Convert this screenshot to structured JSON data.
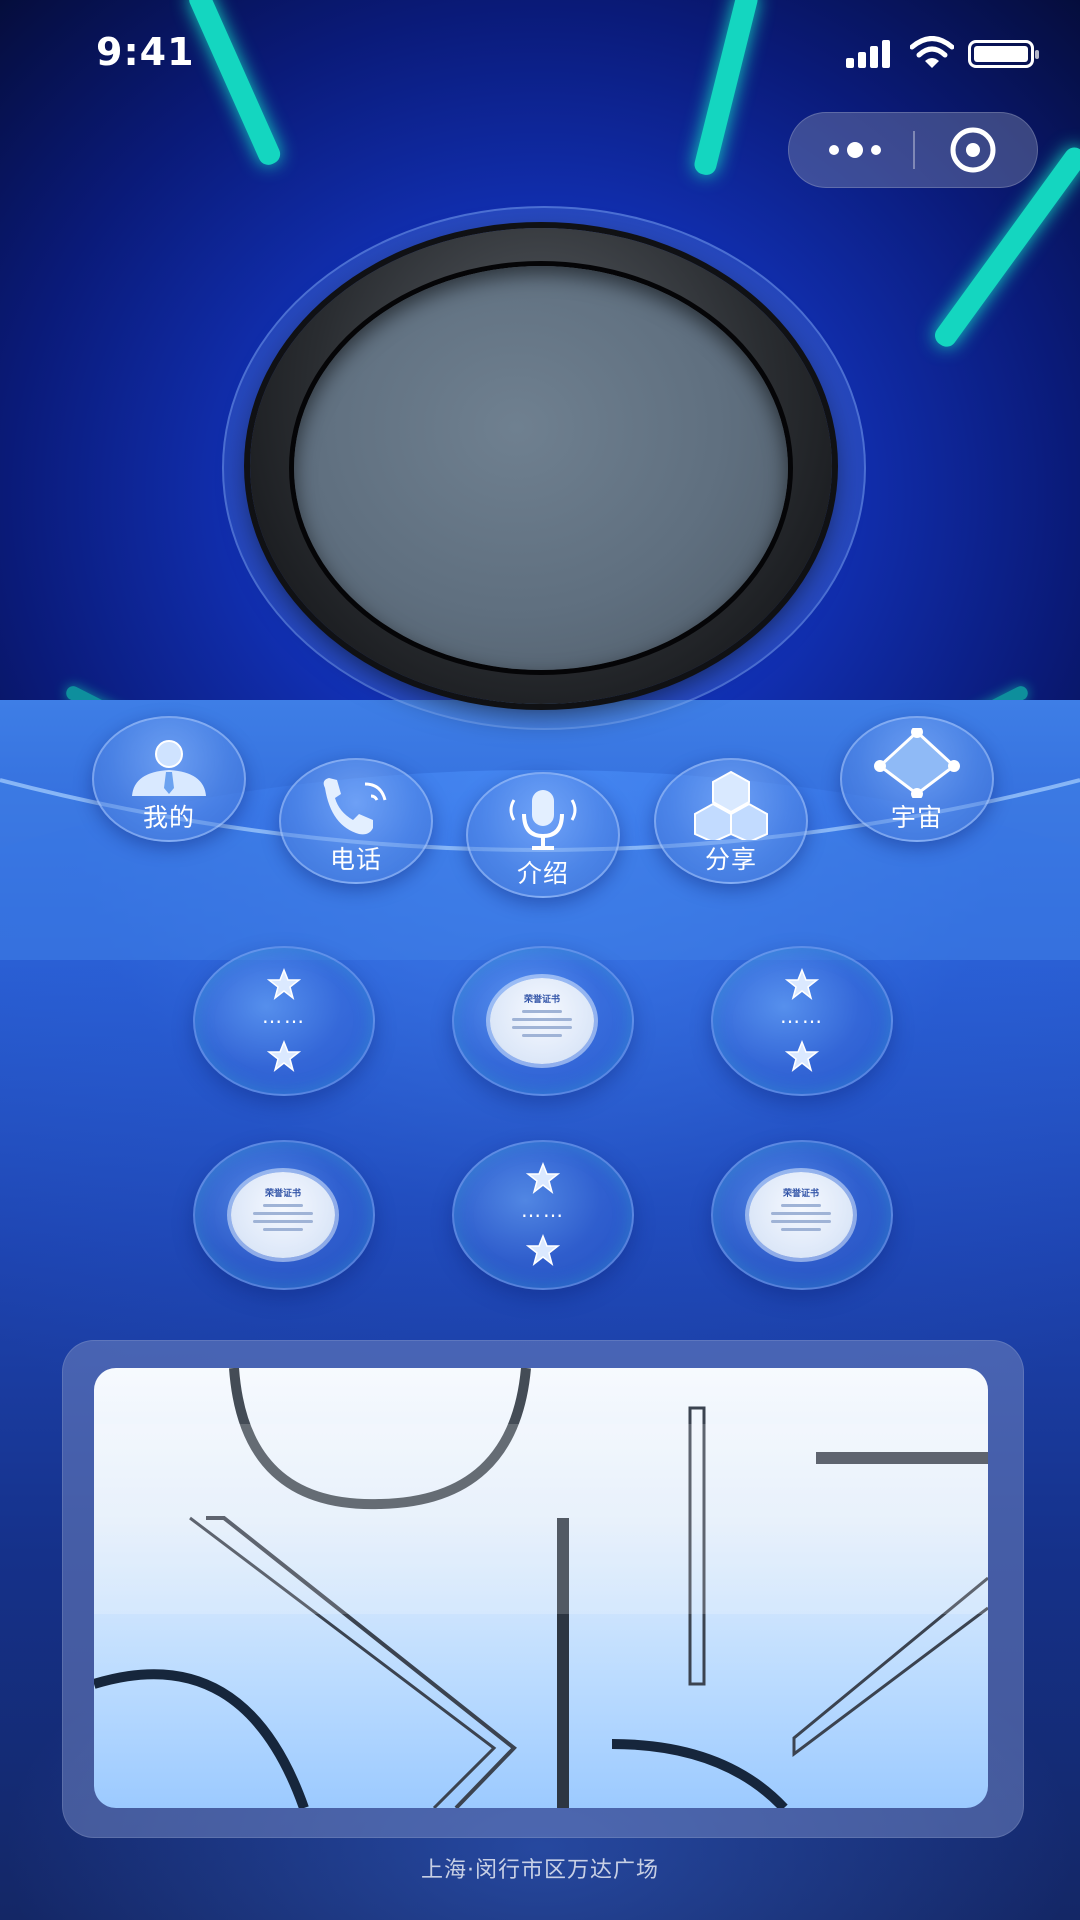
{
  "status_bar": {
    "time": "9:41"
  },
  "functions": [
    {
      "label": "我的",
      "icon": "user-icon"
    },
    {
      "label": "电话",
      "icon": "phone-icon"
    },
    {
      "label": "介绍",
      "icon": "microphone-icon"
    },
    {
      "label": "分享",
      "icon": "cubes-icon"
    },
    {
      "label": "宇宙",
      "icon": "network-diamond-icon"
    }
  ],
  "grid": {
    "placeholder_dots": "……",
    "certificate_title": "荣誉证书"
  },
  "footer": {
    "address": "上海·闵行市区万达广场"
  },
  "colors": {
    "neon": "#14d6c0",
    "accent_blue": "#2c62d6"
  }
}
